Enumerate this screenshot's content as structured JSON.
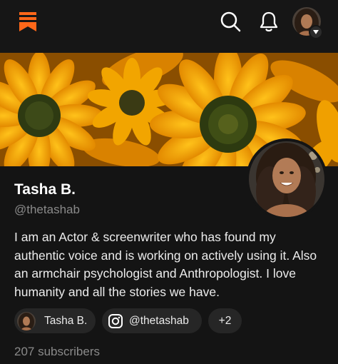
{
  "header": {
    "logo_icon": "substack-logo-icon",
    "search_icon": "search-icon",
    "notifications_icon": "bell-icon",
    "account_menu_icon": "chevron-down-icon"
  },
  "colors": {
    "accent": "#ff6719",
    "background": "#141414",
    "chip_background": "#262626",
    "muted_text": "#8a8a8a"
  },
  "profile": {
    "name": "Tasha B.",
    "handle": "@thetashab",
    "bio": "I am an Actor & screenwriter who has found my authentic voice and is working on actively using it. Also an armchair psychologist and Anthropologist. I love humanity and all the stories we have.",
    "subscribers": "207 subscribers"
  },
  "links": {
    "profile_chip": "Tasha B.",
    "instagram_chip": "@thetashab",
    "more_chip": "+2"
  }
}
